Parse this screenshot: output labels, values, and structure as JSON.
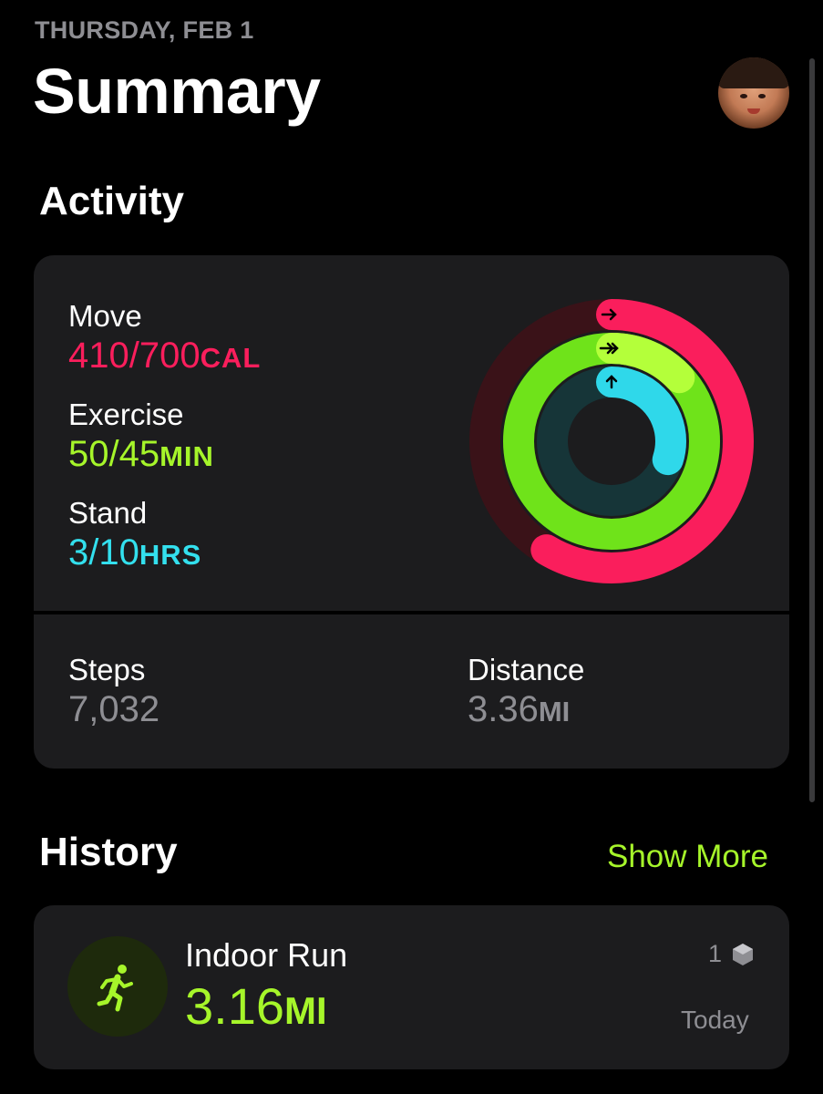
{
  "header": {
    "date": "THURSDAY, FEB 1",
    "title": "Summary"
  },
  "activity": {
    "section_title": "Activity",
    "move": {
      "label": "Move",
      "value": "410/700",
      "unit": "CAL",
      "progress": 0.586,
      "color": "#fa1e5c"
    },
    "exercise": {
      "label": "Exercise",
      "value": "50/45",
      "unit": "MIN",
      "progress": 1.11,
      "color": "#a6f52a"
    },
    "stand": {
      "label": "Stand",
      "value": "3/10",
      "unit": "HRS",
      "progress": 0.3,
      "color": "#33e0ee"
    },
    "steps": {
      "label": "Steps",
      "value": "7,032"
    },
    "distance": {
      "label": "Distance",
      "value": "3.36",
      "unit": "MI"
    }
  },
  "history": {
    "section_title": "History",
    "show_more": "Show More",
    "workout": {
      "name": "Indoor Run",
      "value": "3.16",
      "unit": "MI",
      "award_count": "1",
      "date": "Today",
      "icon": "running-figure-icon"
    }
  }
}
